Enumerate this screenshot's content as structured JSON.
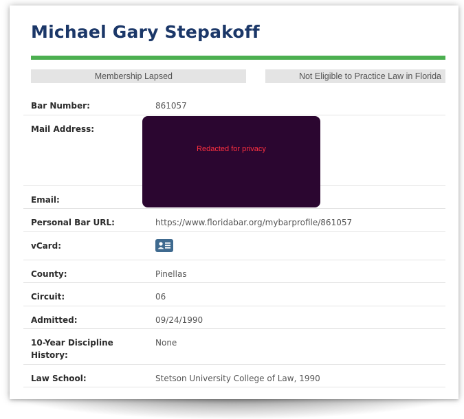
{
  "profile": {
    "name": "Michael Gary Stepakoff",
    "status_membership": "Membership Lapsed",
    "status_eligibility": "Not Eligible to Practice Law in Florida"
  },
  "fields": {
    "bar_number": {
      "label": "Bar Number:",
      "value": "861057"
    },
    "mail_address": {
      "label": "Mail Address:"
    },
    "email": {
      "label": "Email:"
    },
    "personal_bar_url": {
      "label": "Personal Bar URL:",
      "value": "https://www.floridabar.org/mybarprofile/861057"
    },
    "vcard": {
      "label": "vCard:",
      "icon": "vcard-icon"
    },
    "county": {
      "label": "County:",
      "value": "Pinellas"
    },
    "circuit": {
      "label": "Circuit:",
      "value": "06"
    },
    "admitted": {
      "label": "Admitted:",
      "value": "09/24/1990"
    },
    "discipline_history": {
      "label": "10-Year Discipline History:",
      "value": "None"
    },
    "law_school": {
      "label": "Law School:",
      "value": "Stetson University College of Law, 1990"
    }
  },
  "redaction": {
    "text": "Redacted for privacy"
  },
  "colors": {
    "title": "#1b3768",
    "accent_bar": "#4caf50",
    "vcard_icon": "#3f6a8f",
    "redaction_box": "#2b0630",
    "redaction_text": "#ff3040"
  }
}
